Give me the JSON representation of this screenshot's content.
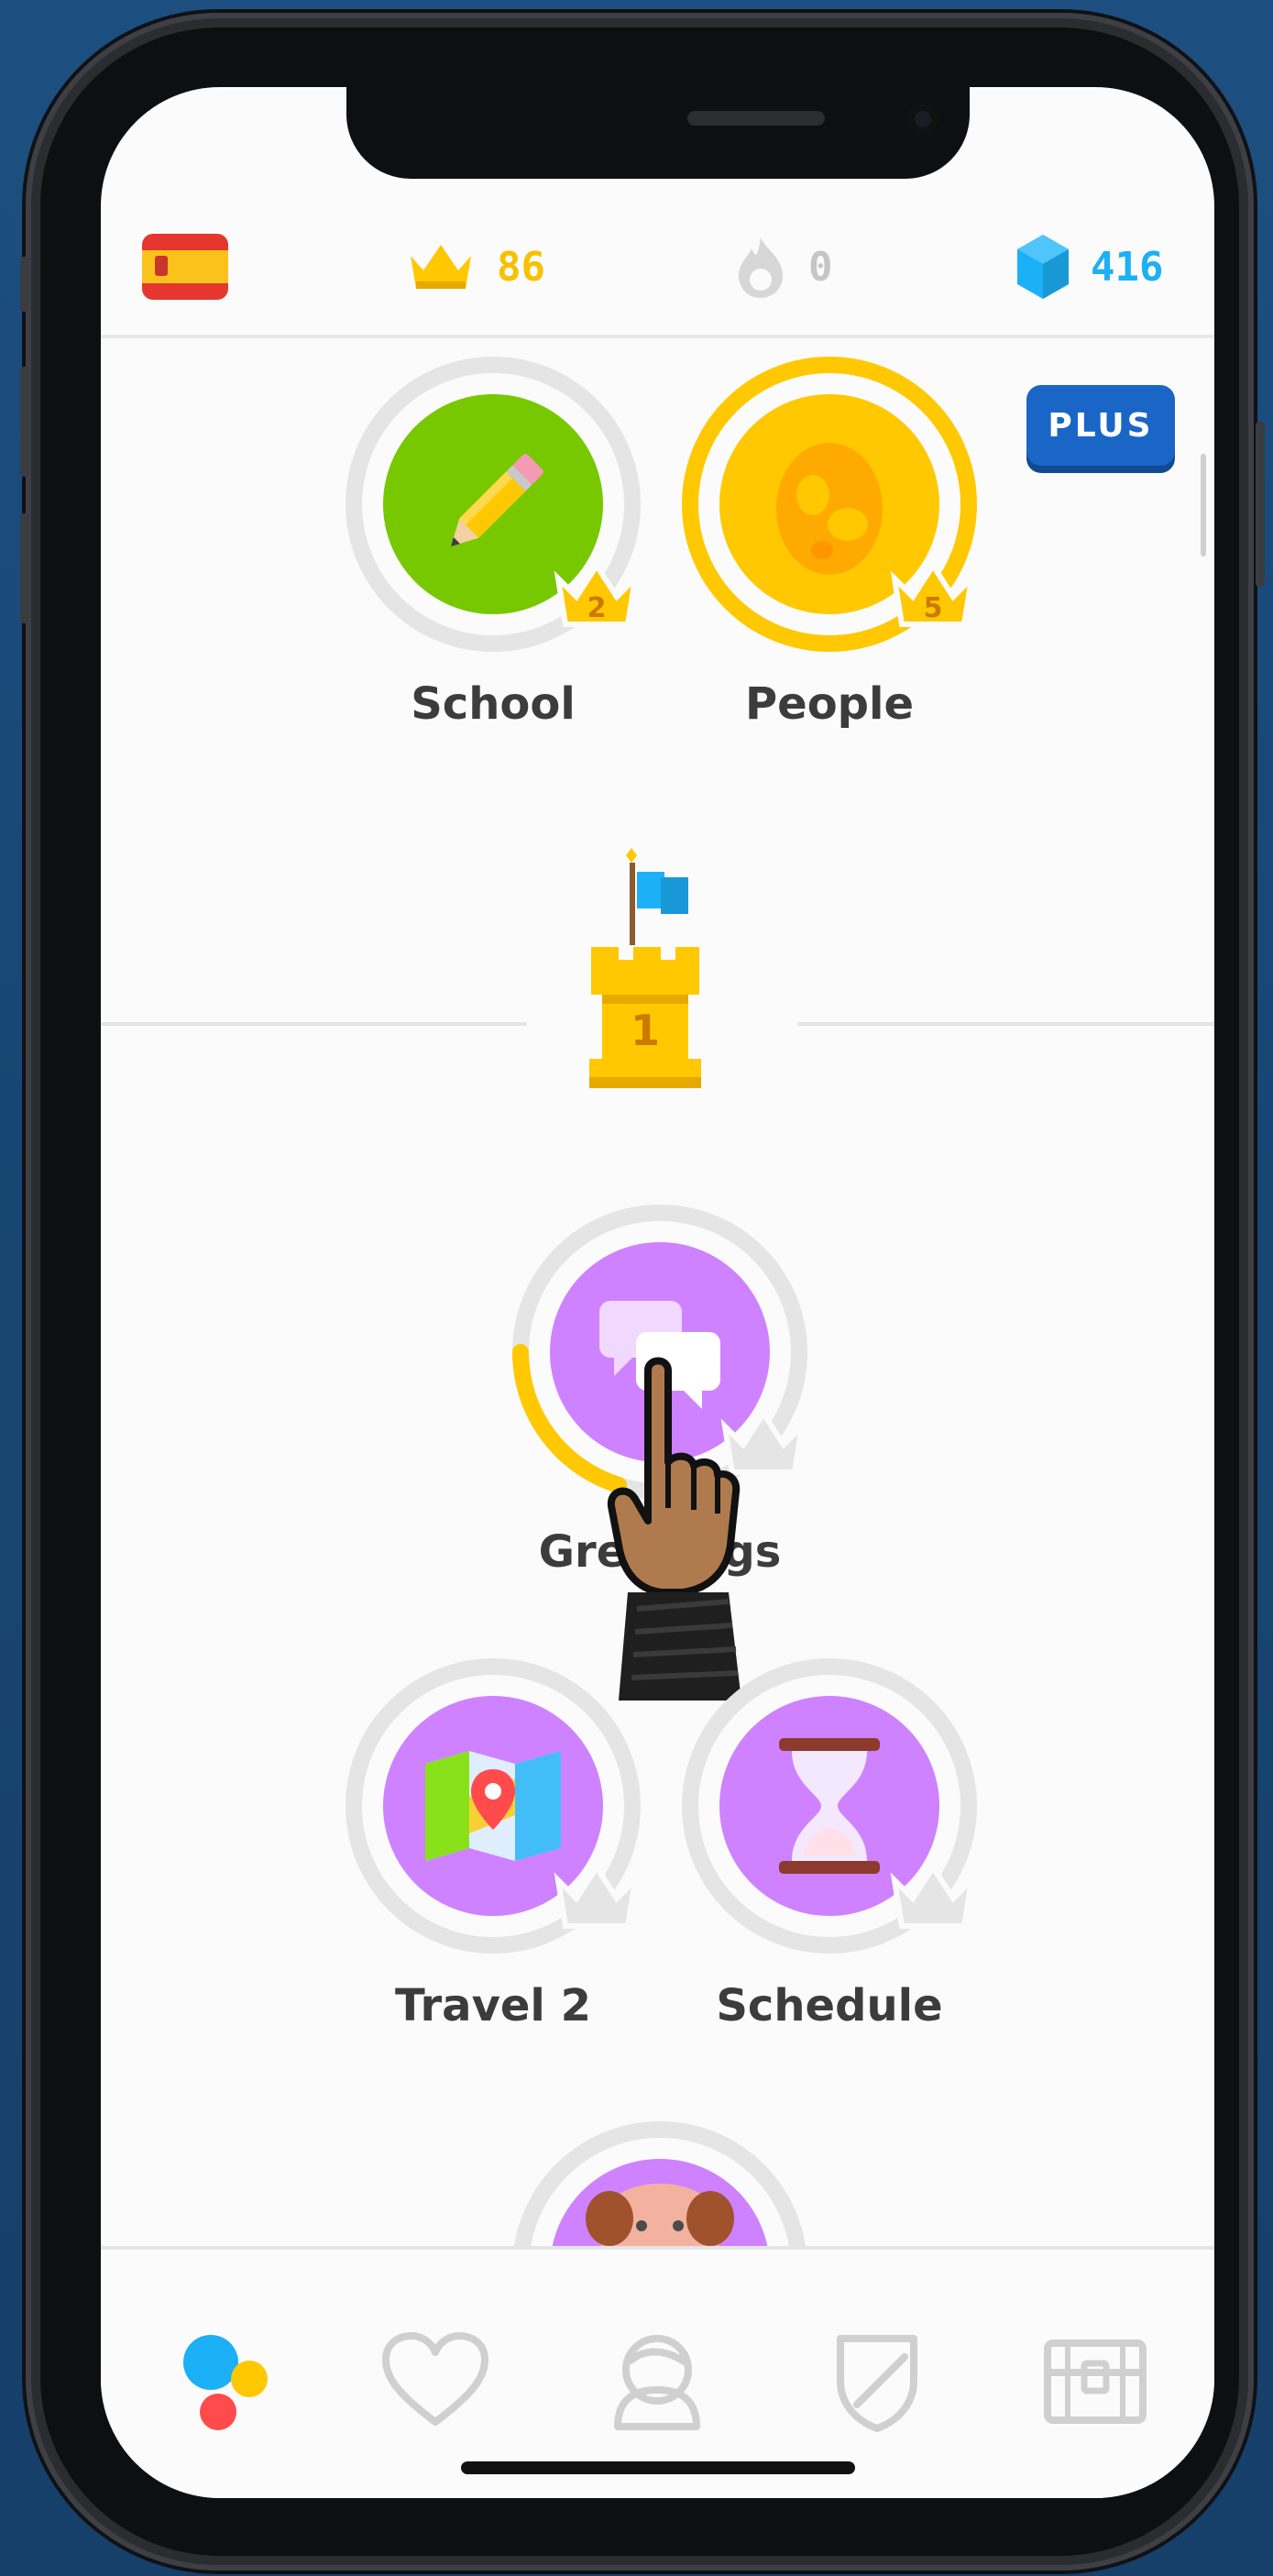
{
  "stats": {
    "language_flag": "spain-flag-icon",
    "crowns": "86",
    "streak": "0",
    "gems": "416"
  },
  "colors": {
    "crown_gold": "#f7c100",
    "gem_blue": "#1cb0f6",
    "plus_blue": "#1a66c7",
    "skill_purple": "#ce82ff",
    "skill_green": "#78c800",
    "progress_gold": "#ffc800"
  },
  "plus_badge": {
    "label": "PLUS"
  },
  "skills": [
    {
      "name": "School",
      "icon": "pencil-icon",
      "crown_level": "2"
    },
    {
      "name": "People",
      "icon": "egg-icon",
      "crown_level": "5"
    },
    {
      "name": "Greetings",
      "icon": "speech-bubbles-icon",
      "progress": 0.3
    },
    {
      "name": "Travel 2",
      "icon": "map-icon"
    },
    {
      "name": "Schedule",
      "icon": "hourglass-icon"
    }
  ],
  "checkpoint": {
    "number": "1"
  },
  "bottom_nav": [
    {
      "name": "learn",
      "icon": "learn-dots-icon"
    },
    {
      "name": "stories",
      "icon": "heart-icon"
    },
    {
      "name": "profile",
      "icon": "profile-icon"
    },
    {
      "name": "leaderboards",
      "icon": "shield-icon"
    },
    {
      "name": "shop",
      "icon": "treasure-chest-icon"
    }
  ]
}
